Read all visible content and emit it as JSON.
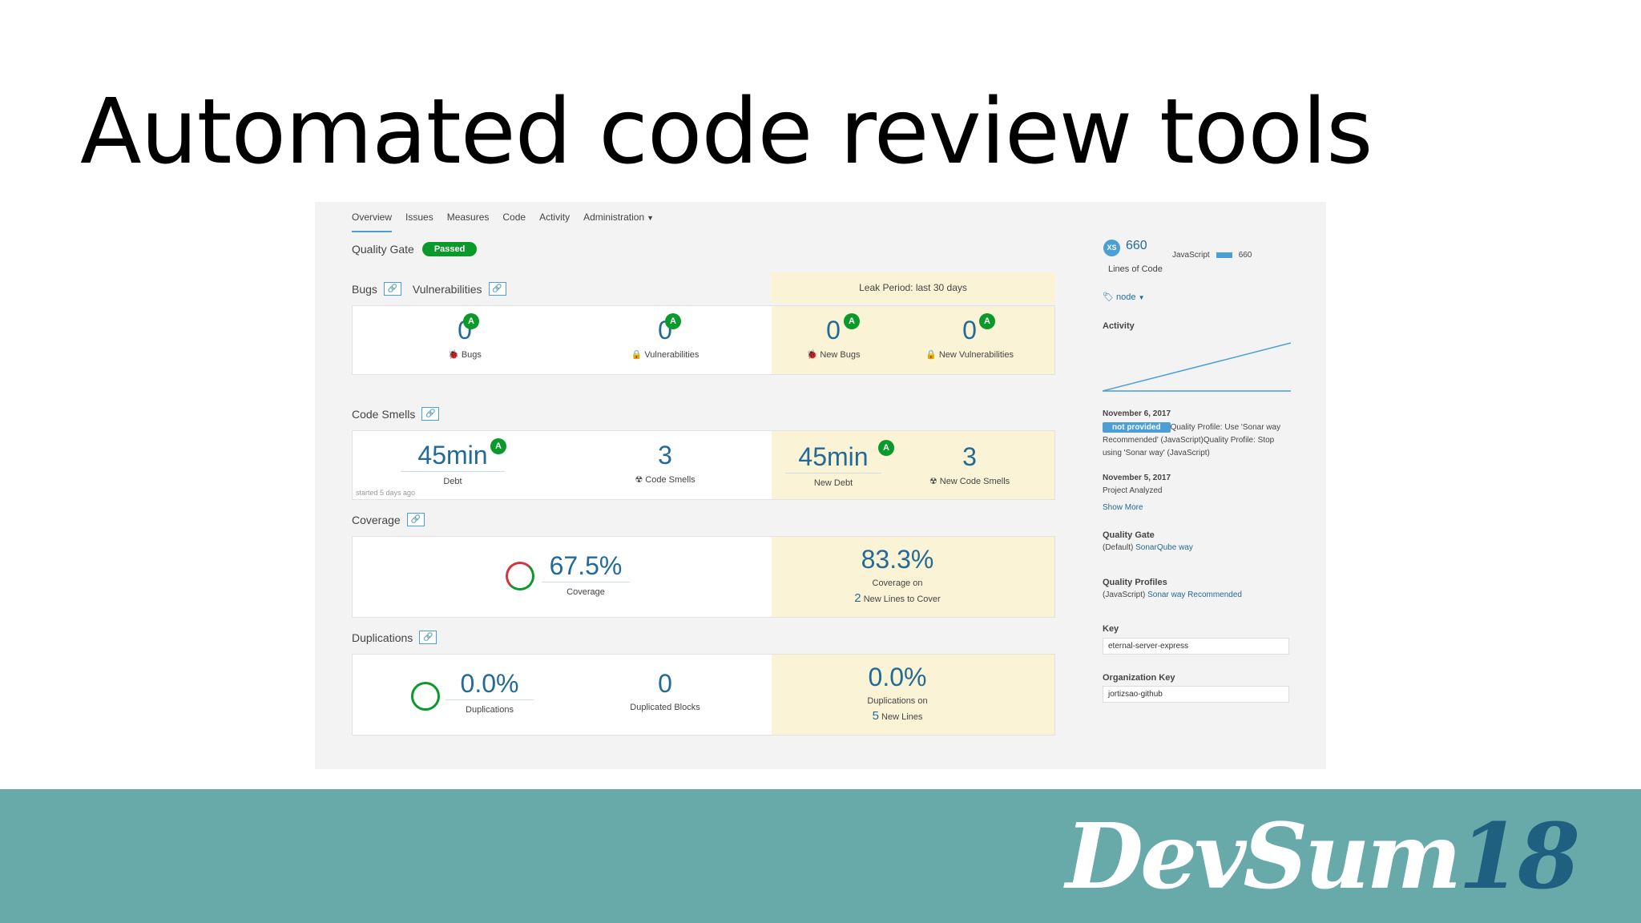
{
  "slide": {
    "title": "Automated code review tools",
    "logo_word": "DevSum",
    "logo_year": "18"
  },
  "nav": {
    "items": [
      "Overview",
      "Issues",
      "Measures",
      "Code",
      "Activity",
      "Administration"
    ]
  },
  "quality_gate": {
    "label": "Quality Gate",
    "status": "Passed"
  },
  "leak_period": "Leak Period: last 30 days",
  "bugs_section": {
    "bugs_title": "Bugs",
    "vulns_title": "Vulnerabilities",
    "bugs_value": "0",
    "bugs_label": "Bugs",
    "bugs_rating": "A",
    "vulns_value": "0",
    "vulns_label": "Vulnerabilities",
    "vulns_rating": "A",
    "new_bugs_value": "0",
    "new_bugs_label": "New Bugs",
    "new_bugs_rating": "A",
    "new_vulns_value": "0",
    "new_vulns_label": "New Vulnerabilities",
    "new_vulns_rating": "A"
  },
  "code_smells": {
    "title": "Code Smells",
    "debt_value": "45min",
    "debt_label": "Debt",
    "debt_rating": "A",
    "smells_value": "3",
    "smells_label": "Code Smells",
    "new_debt_value": "45min",
    "new_debt_label": "New Debt",
    "new_debt_rating": "A",
    "new_smells_value": "3",
    "new_smells_label": "New Code Smells",
    "note": "started 5 days ago"
  },
  "coverage": {
    "title": "Coverage",
    "value": "67.5%",
    "label": "Coverage",
    "new_value": "83.3%",
    "new_label": "Coverage on",
    "new_lines_value": "2",
    "new_lines_label": "New Lines to Cover"
  },
  "duplications": {
    "title": "Duplications",
    "value": "0.0%",
    "label": "Duplications",
    "blocks_value": "0",
    "blocks_label": "Duplicated Blocks",
    "new_value": "0.0%",
    "new_label": "Duplications on",
    "new_lines_value": "5",
    "new_lines_label": "New Lines"
  },
  "sidebar": {
    "size_badge": "XS",
    "loc_value": "660",
    "loc_label": "Lines of Code",
    "lang_name": "JavaScript",
    "lang_value": "660",
    "tag": "node",
    "activity_title": "Activity",
    "event1_date": "November 6, 2017",
    "event1_badge": "not provided",
    "event1_text": "Quality Profile: Use 'Sonar way Recommended' (JavaScript)Quality Profile: Stop using 'Sonar way' (JavaScript)",
    "event2_date": "November 5, 2017",
    "event2_text": "Project Analyzed",
    "show_more": "Show More",
    "qg_title": "Quality Gate",
    "qg_default": "(Default)",
    "qg_link": "SonarQube way",
    "qp_title": "Quality Profiles",
    "qp_lang": "(JavaScript)",
    "qp_link": "Sonar way Recommended",
    "key_title": "Key",
    "key_value": "eternal-server-express",
    "org_title": "Organization Key",
    "org_value": "jortizsao-github"
  },
  "colors": {
    "accent": "#4b9fd5",
    "value_blue": "#236a97",
    "passed_green": "#0a9a2b",
    "leak_bg": "#fbf3d5",
    "footer": "#68aaaa"
  }
}
